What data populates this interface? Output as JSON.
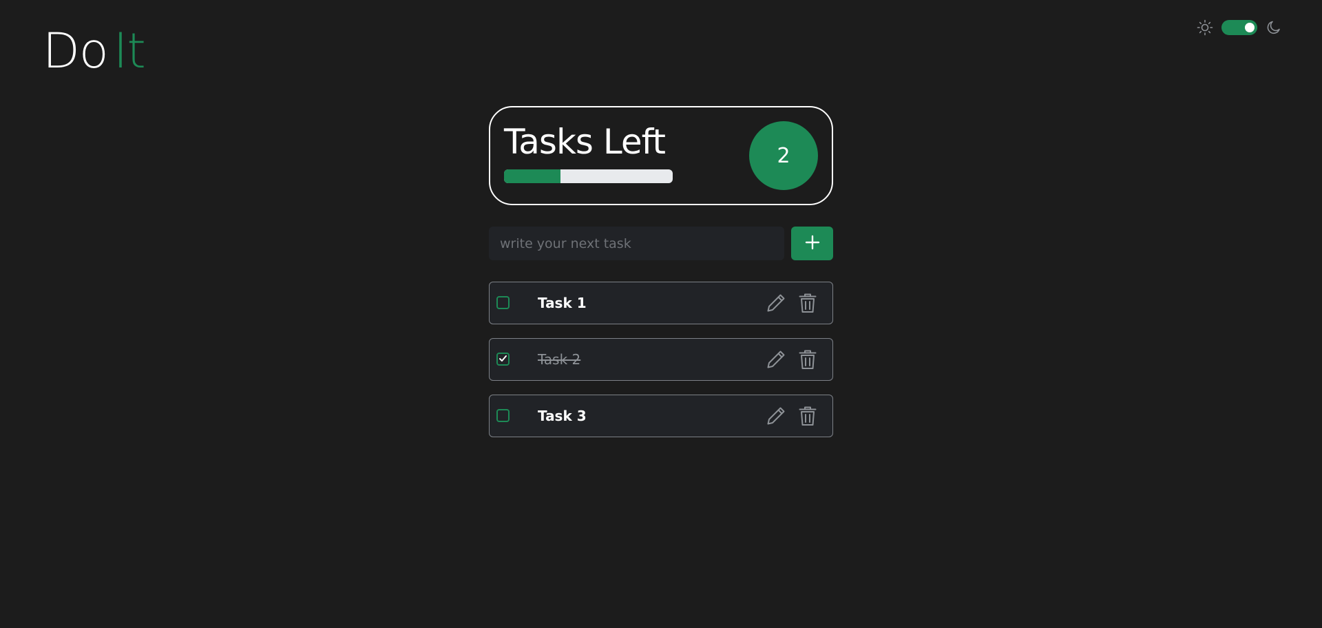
{
  "logo": {
    "part1": "Do",
    "part2": "It"
  },
  "theme": {
    "light_icon": "sun-icon",
    "dark_icon": "moon-icon",
    "dark_mode": true
  },
  "summary": {
    "title": "Tasks Left",
    "count": "2",
    "progress_fraction": 0.333
  },
  "new_task": {
    "placeholder": "write your next task",
    "value": "",
    "add_icon": "plus-icon"
  },
  "tasks": [
    {
      "label": "Task 1",
      "done": false
    },
    {
      "label": "Task 2",
      "done": true
    },
    {
      "label": "Task 3",
      "done": false
    }
  ],
  "icons": {
    "edit": "pencil-icon",
    "delete": "trash-icon",
    "check": "check-icon"
  },
  "colors": {
    "accent": "#1d8a56",
    "background": "#1c1c1c",
    "card": "#212327",
    "muted_icon": "#8e9297"
  }
}
